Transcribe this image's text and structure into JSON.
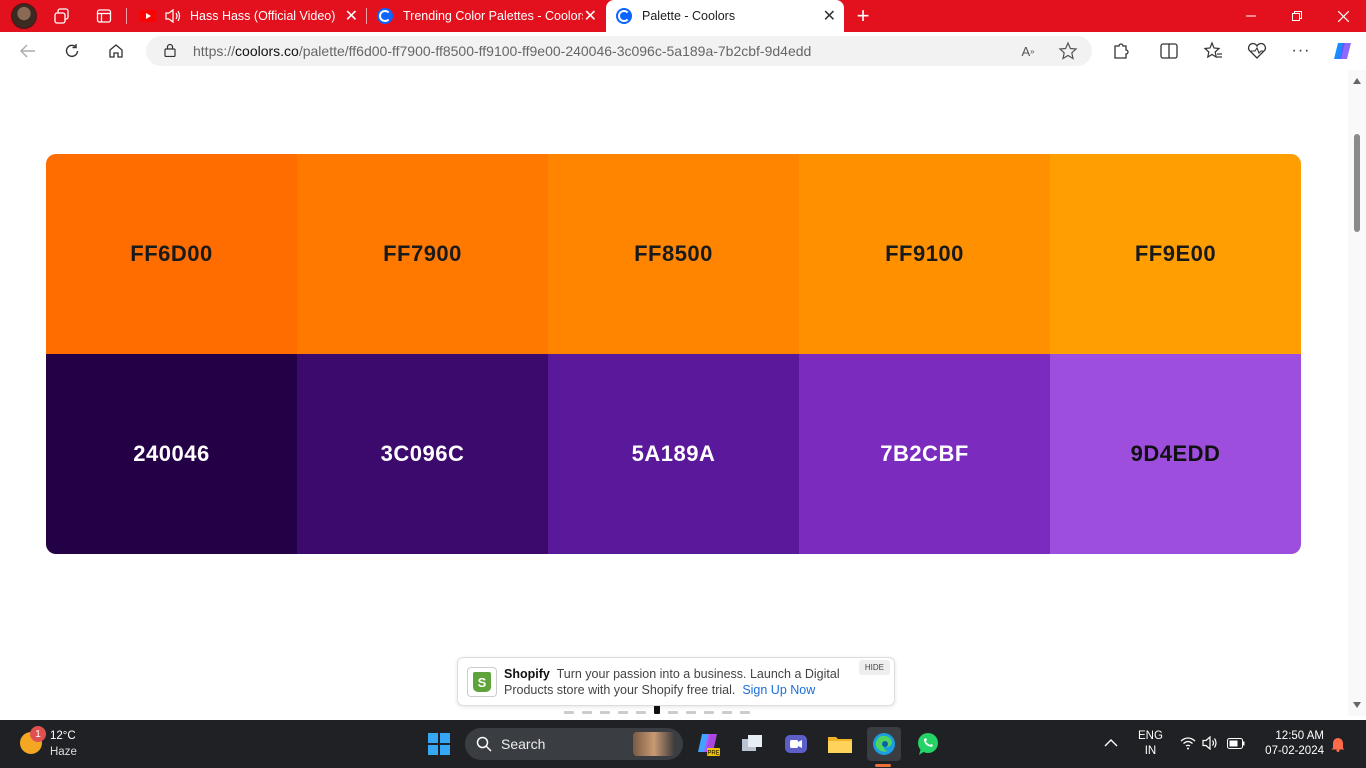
{
  "browser": {
    "tabs": [
      {
        "title": "Hass Hass (Official Video) D",
        "type": "youtube",
        "audio": true
      },
      {
        "title": "Trending Color Palettes - Coolors",
        "type": "coolors"
      },
      {
        "title": "Palette - Coolors",
        "type": "coolors",
        "active": true
      }
    ],
    "new_tab_label": "+",
    "url_prefix": "https://",
    "url_domain": "coolors.co",
    "url_path": "/palette/ff6d00-ff7900-ff8500-ff9100-ff9e00-240046-3c096c-5a189a-7b2cbf-9d4edd"
  },
  "palette": {
    "swatches": [
      {
        "hex": "FF6D00",
        "color": "#ff6d00",
        "text_color": "#1a1a1a"
      },
      {
        "hex": "FF7900",
        "color": "#ff7900",
        "text_color": "#1a1a1a"
      },
      {
        "hex": "FF8500",
        "color": "#ff8500",
        "text_color": "#1a1a1a"
      },
      {
        "hex": "FF9100",
        "color": "#ff9100",
        "text_color": "#1a1a1a"
      },
      {
        "hex": "FF9E00",
        "color": "#ff9e00",
        "text_color": "#1a1a1a"
      },
      {
        "hex": "240046",
        "color": "#240046",
        "text_color": "#ffffff"
      },
      {
        "hex": "3C096C",
        "color": "#3c096c",
        "text_color": "#ffffff"
      },
      {
        "hex": "5A189A",
        "color": "#5a189a",
        "text_color": "#ffffff"
      },
      {
        "hex": "7B2CBF",
        "color": "#7b2cbf",
        "text_color": "#ffffff"
      },
      {
        "hex": "9D4EDD",
        "color": "#9d4edd",
        "text_color": "#111111"
      }
    ]
  },
  "ad": {
    "brand": "Shopify",
    "text": "Turn your passion into a business. Launch a Digital Products store with your Shopify free trial.",
    "cta": "Sign Up Now",
    "hide_label": "HIDE"
  },
  "taskbar": {
    "weather_temp": "12°C",
    "weather_condition": "Haze",
    "weather_badge": "1",
    "search_label": "Search",
    "lang_line1": "ENG",
    "lang_line2": "IN",
    "time": "12:50 AM",
    "date": "07-02-2024"
  },
  "colors": {
    "tabstrip": "#e3101e",
    "taskbar": "#1f2124"
  }
}
